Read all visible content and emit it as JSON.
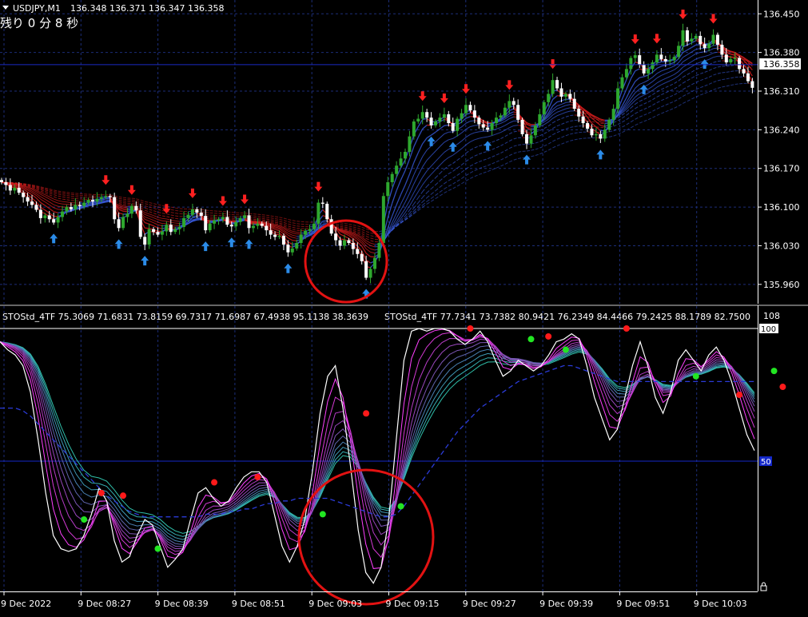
{
  "colors": {
    "background": "#000000",
    "bull_candle": "#2ea82e",
    "bear_candle": "#ffffff",
    "grid": "#1c2d78",
    "axis_text": "#ffffff",
    "price_line": "#1a2bc4",
    "up_arrow": "#2b8be8",
    "down_arrow": "#ff2020",
    "ribbon_up": "#3a5ce0",
    "ribbon_down": "#d81e1e",
    "sto_main": "#ffffff",
    "sto_lines": [
      "#ff40ff",
      "#d63ad6",
      "#b83cc8",
      "#9a47bd",
      "#7c55b4",
      "#5e64ab",
      "#4a80b2",
      "#3f99b5",
      "#36b0b3",
      "#2fbfa9"
    ],
    "sto_signal": "#2b3bd8",
    "dot_red": "#ff1a1a",
    "dot_green": "#22e622",
    "circle": "#e21212",
    "level_line": "#1428c8"
  },
  "main": {
    "title": "USDJPY,M1",
    "ohlc": "136.348 136.371 136.347 136.358",
    "countdown": "残り 0 分 8 秒",
    "current_price": "136.358"
  },
  "sub": {
    "label_1": "STOStd_4TF 75.3069 71.6831 73.8159 69.7317 71.6987 67.4938 95.1138 38.3639",
    "label_2": "STOStd_4TF 77.7341 73.7382 80.9421 76.2349 84.4466 79.2425 88.1789 82.7500",
    "top_value": "100",
    "level_value": "50",
    "axis_label_108": "108"
  },
  "chart_data": [
    {
      "type": "candlestick",
      "title": "USDJPY,M1",
      "ylim": [
        135.925,
        136.475
      ],
      "y_ticks": [
        "136.450",
        "136.380",
        "136.310",
        "136.240",
        "136.170",
        "136.100",
        "136.030",
        "135.960"
      ],
      "x_ticks": [
        "9 Dec 2022",
        "9 Dec 08:27",
        "9 Dec 08:39",
        "9 Dec 08:51",
        "9 Dec 09:03",
        "9 Dec 09:15",
        "9 Dec 09:27",
        "9 Dec 09:39",
        "9 Dec 09:51",
        "9 Dec 10:03"
      ],
      "close": [
        136.145,
        136.14,
        136.13,
        136.135,
        136.126,
        136.118,
        136.11,
        136.104,
        136.095,
        136.08,
        136.085,
        136.078,
        136.072,
        136.082,
        136.092,
        136.1,
        136.096,
        136.104,
        136.102,
        136.108,
        136.113,
        136.11,
        136.115,
        136.118,
        136.12,
        136.118,
        136.078,
        136.062,
        136.082,
        136.088,
        136.102,
        136.094,
        136.046,
        136.032,
        136.06,
        136.055,
        136.05,
        136.056,
        136.068,
        136.055,
        136.06,
        136.064,
        136.08,
        136.086,
        136.096,
        136.09,
        136.084,
        136.058,
        136.07,
        136.076,
        136.078,
        136.082,
        136.068,
        136.065,
        136.073,
        136.08,
        136.085,
        136.062,
        136.066,
        136.07,
        136.066,
        136.058,
        136.05,
        136.046,
        136.048,
        136.032,
        136.018,
        136.025,
        136.035,
        136.05,
        136.057,
        136.06,
        136.07,
        136.108,
        136.106,
        136.078,
        136.052,
        136.04,
        136.03,
        136.04,
        136.035,
        136.024,
        136.015,
        136.002,
        135.972,
        135.988,
        136.008,
        136.035,
        136.12,
        136.145,
        136.16,
        136.175,
        136.188,
        136.2,
        136.228,
        136.255,
        136.26,
        136.272,
        136.262,
        136.248,
        136.255,
        136.262,
        136.268,
        136.252,
        136.238,
        136.26,
        136.27,
        136.285,
        136.275,
        136.262,
        136.25,
        136.244,
        136.24,
        136.252,
        136.262,
        136.266,
        136.28,
        136.292,
        136.285,
        136.258,
        136.232,
        136.215,
        136.23,
        136.248,
        136.268,
        136.29,
        136.305,
        136.33,
        136.315,
        136.3,
        136.305,
        136.296,
        136.278,
        136.264,
        136.252,
        136.242,
        136.23,
        136.232,
        136.224,
        136.24,
        136.258,
        136.278,
        136.315,
        136.335,
        136.35,
        136.37,
        136.375,
        136.358,
        136.342,
        136.35,
        136.362,
        136.376,
        136.368,
        136.364,
        136.366,
        136.372,
        136.392,
        136.42,
        136.4,
        136.405,
        136.41,
        136.395,
        136.388,
        136.396,
        136.412,
        136.394,
        136.376,
        136.362,
        136.368,
        136.37,
        136.35,
        136.342,
        136.328,
        136.316
      ],
      "series": [
        {
          "name": "STOStd_4TF",
          "pane": "sub",
          "ylim": [
            0,
            100
          ]
        }
      ]
    },
    {
      "type": "line",
      "title": "STOStd_4TF",
      "ylim": [
        0,
        100
      ],
      "levels": [
        50
      ],
      "x_ticks": [
        "9 Dec 2022",
        "9 Dec 08:27",
        "9 Dec 08:39",
        "9 Dec 08:51",
        "9 Dec 09:03",
        "9 Dec 09:15",
        "9 Dec 09:27",
        "9 Dec 09:39",
        "9 Dec 09:51",
        "9 Dec 10:03"
      ],
      "main_values": [
        95,
        92,
        90,
        86,
        76,
        58,
        38,
        22,
        17,
        16,
        17,
        22,
        30,
        40,
        35,
        20,
        12,
        14,
        22,
        28,
        26,
        18,
        10,
        13,
        17,
        28,
        38,
        40,
        36,
        33,
        35,
        40,
        44,
        46,
        46,
        42,
        30,
        18,
        12,
        18,
        28,
        46,
        68,
        82,
        86,
        70,
        48,
        24,
        8,
        4,
        10,
        28,
        58,
        88,
        99,
        100,
        99,
        100,
        100,
        99,
        96,
        94,
        96,
        99,
        95,
        88,
        82,
        84,
        88,
        86,
        84,
        86,
        90,
        95,
        96,
        98,
        96,
        86,
        74,
        66,
        58,
        62,
        74,
        86,
        95,
        86,
        74,
        68,
        76,
        88,
        92,
        88,
        84,
        90,
        93,
        88,
        80,
        70,
        60,
        54
      ],
      "signal_values": [
        70,
        70,
        70,
        69,
        67,
        64,
        61,
        58,
        55,
        52,
        49,
        46,
        43,
        40,
        37,
        35,
        33,
        31,
        30,
        29,
        29,
        29,
        29,
        29,
        29,
        29,
        29,
        30,
        30,
        30,
        31,
        31,
        32,
        32,
        33,
        34,
        34,
        35,
        35,
        36,
        36,
        36,
        36,
        36,
        35,
        34,
        33,
        32,
        31,
        30,
        29,
        29,
        30,
        33,
        37,
        41,
        45,
        49,
        53,
        57,
        61,
        64,
        67,
        70,
        72,
        74,
        76,
        78,
        80,
        81,
        82,
        83,
        84,
        85,
        86,
        86,
        85,
        84,
        83,
        82,
        81,
        80,
        80,
        80,
        80,
        80,
        80,
        80,
        80,
        80,
        80,
        80,
        80,
        80,
        80,
        80,
        80,
        80,
        80,
        80
      ],
      "red_dots": [
        [
          23,
          38
        ],
        [
          28,
          37
        ],
        [
          49,
          42
        ],
        [
          59,
          44
        ],
        [
          84,
          68
        ],
        [
          108,
          100
        ],
        [
          126,
          97
        ],
        [
          144,
          100
        ],
        [
          170,
          75
        ],
        [
          180,
          78
        ]
      ],
      "green_dots": [
        [
          19,
          28
        ],
        [
          36,
          17
        ],
        [
          74,
          30
        ],
        [
          92,
          33
        ],
        [
          122,
          96
        ],
        [
          130,
          92
        ],
        [
          160,
          82
        ],
        [
          178,
          84
        ]
      ]
    }
  ]
}
